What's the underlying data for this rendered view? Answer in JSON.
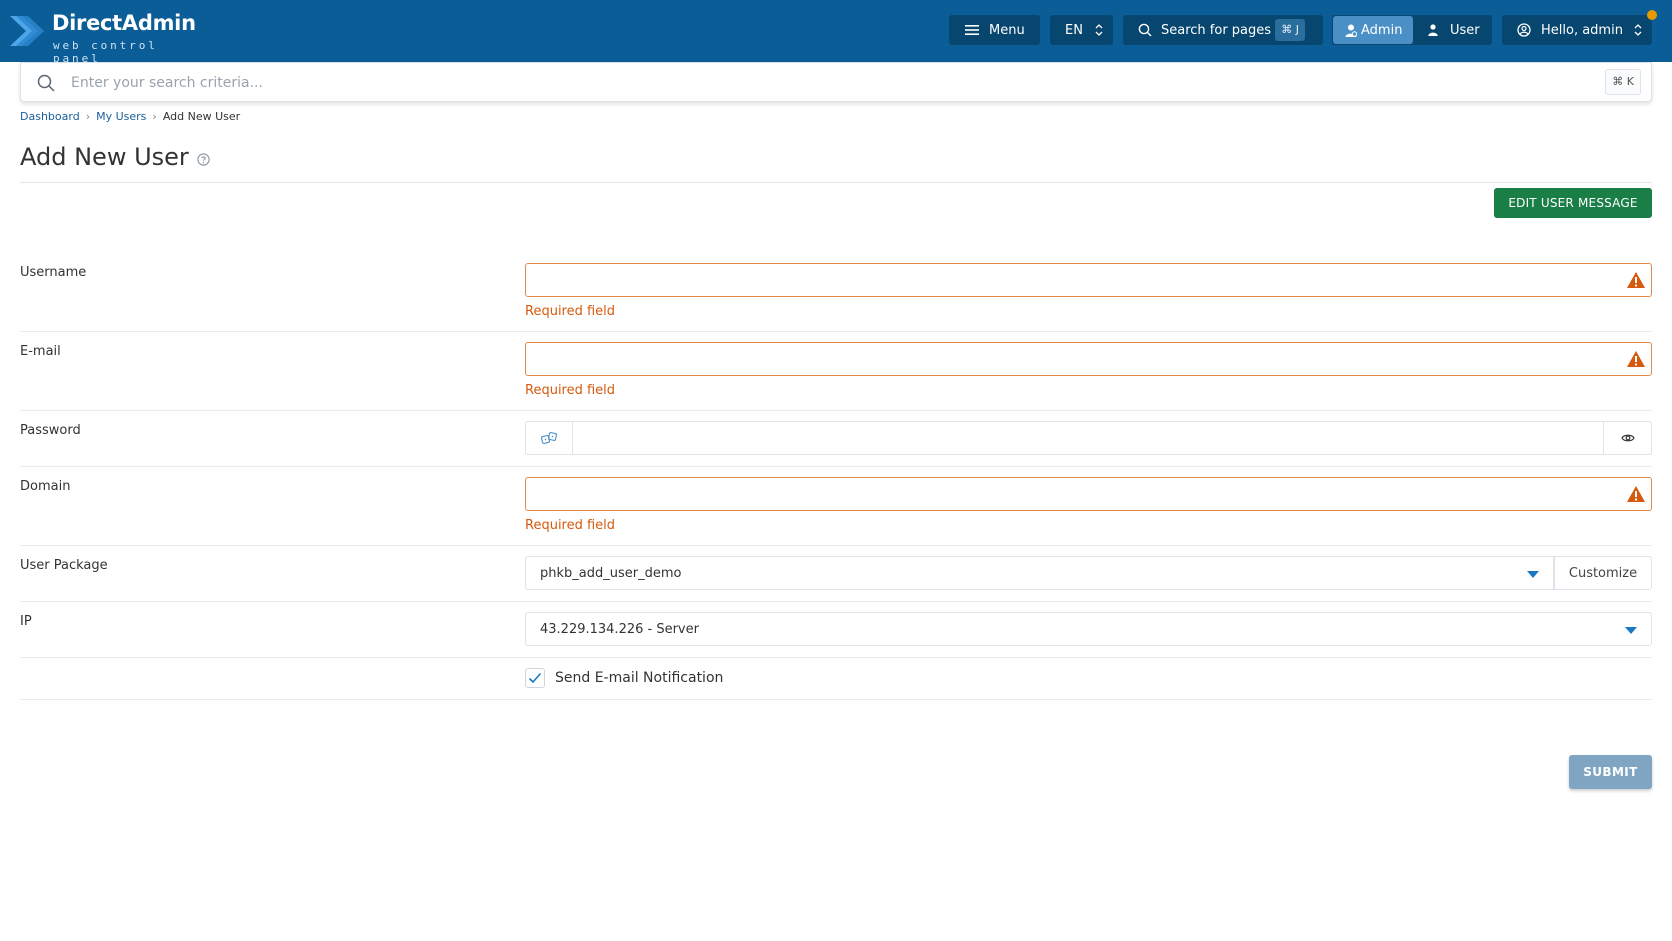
{
  "header": {
    "logo_title": "DirectAdmin",
    "logo_subtitle": "web control panel",
    "menu_label": "Menu",
    "language": "EN",
    "search_pages_label": "Search for pages",
    "search_pages_shortcut": "⌘ J",
    "role_admin_label": "Admin",
    "role_user_label": "User",
    "greeting": "Hello, admin",
    "brand_color": "#0a5d96"
  },
  "search": {
    "placeholder": "Enter your search criteria...",
    "shortcut": "⌘ K"
  },
  "breadcrumb": {
    "items": [
      "Dashboard",
      "My Users",
      "Add New User"
    ]
  },
  "page": {
    "title": "Add New User",
    "edit_message_button": "EDIT USER MESSAGE"
  },
  "form": {
    "username": {
      "label": "Username",
      "value": "",
      "error": "Required field"
    },
    "email": {
      "label": "E-mail",
      "value": "",
      "error": "Required field"
    },
    "password": {
      "label": "Password",
      "value": ""
    },
    "domain": {
      "label": "Domain",
      "value": "",
      "error": "Required field"
    },
    "package": {
      "label": "User Package",
      "value": "phkb_add_user_demo",
      "customize_label": "Customize"
    },
    "ip": {
      "label": "IP",
      "value": "43.229.134.226 - Server"
    },
    "notification": {
      "label": "Send E-mail Notification",
      "checked": true
    },
    "submit_label": "SUBMIT"
  },
  "colors": {
    "error": "#d65a0e",
    "primary_green": "#1a7f46",
    "accent_blue": "#1a78c2"
  }
}
